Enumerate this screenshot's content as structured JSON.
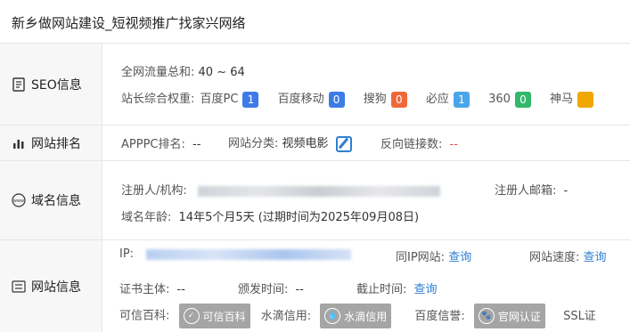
{
  "page_title": "新乡做网站建设_短视频推广找家兴网络",
  "seo": {
    "label": "SEO信息",
    "traffic_label": "全网流量总和:",
    "traffic_value": "40 ~ 64",
    "weight_label": "站长综合权重:",
    "engines": [
      {
        "name": "百度PC",
        "value": "1",
        "color": "#3d7be6"
      },
      {
        "name": "百度移动",
        "value": "0",
        "color": "#3d7be6"
      },
      {
        "name": "搜狗",
        "value": "0",
        "color": "#f0683a"
      },
      {
        "name": "必应",
        "value": "1",
        "color": "#4aa6e8"
      },
      {
        "name": "360",
        "value": "0",
        "color": "#33b86a"
      },
      {
        "name": "神马",
        "value": "",
        "color": "#f0a800"
      }
    ]
  },
  "rank": {
    "label": "网站排名",
    "apppc_label": "APPPC排名:",
    "apppc_value": "--",
    "category_label": "网站分类:",
    "category_value": "视频电影",
    "backlinks_label": "反向链接数:",
    "backlinks_value": "--"
  },
  "domain": {
    "label": "域名信息",
    "registrant_label": "注册人/机构:",
    "email_label": "注册人邮箱:",
    "email_value": "-",
    "age_label": "域名年龄:",
    "age_value": "14年5个月5天 (过期时间为2025年09月08日)"
  },
  "site": {
    "label": "网站信息",
    "ip_label": "IP:",
    "same_ip_label": "同IP网站:",
    "same_ip_link": "查询",
    "speed_label": "网站速度:",
    "speed_link": "查询",
    "cert_subject_label": "证书主体:",
    "cert_subject_value": "--",
    "issue_label": "颁发时间:",
    "issue_value": "--",
    "expire_label": "截止时间:",
    "expire_link": "查询",
    "baike_label": "可信百科:",
    "baike_badge": "可信百科",
    "water_label": "水滴信用:",
    "water_badge": "水滴信用",
    "baidu_label": "百度信誉:",
    "baidu_badge": "官网认证",
    "ssl_label": "SSL证"
  }
}
